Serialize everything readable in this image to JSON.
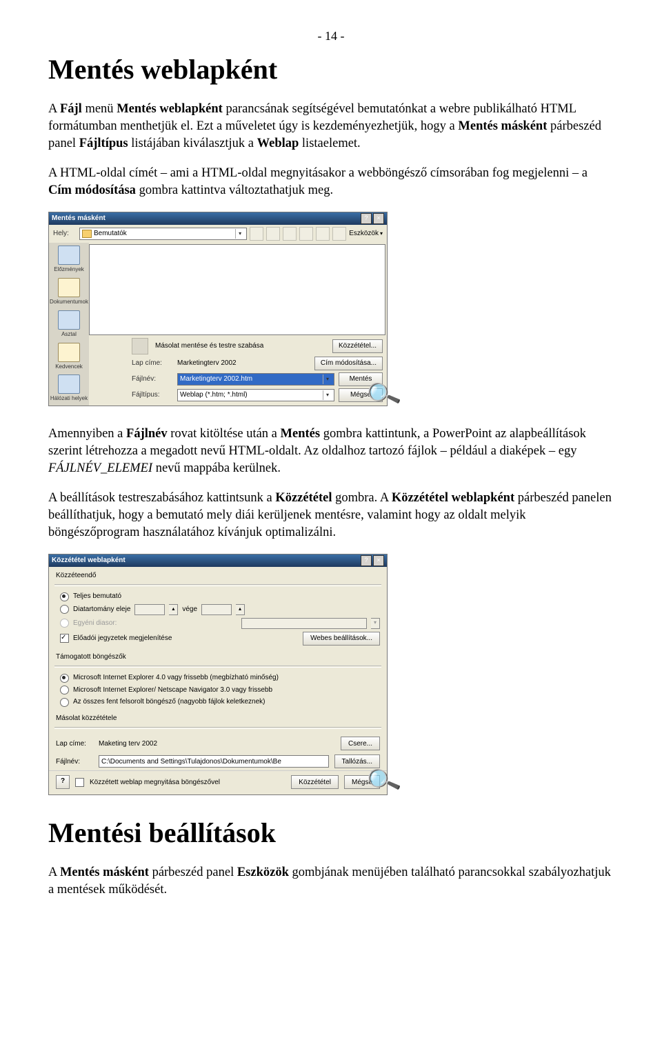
{
  "pageNumber": "- 14 -",
  "h1": "Mentés weblapként",
  "para1": "A Fájl menü Mentés weblapként parancsának segítségével bemutatónkat a webre publikálható HTML formátumban menthetjük el. Ezt a műveletet úgy is kezdeményezhetjük, hogy a Mentés másként párbeszéd panel Fájltípus listájában kiválasztjuk a Weblap listaelemet.",
  "para2": "A HTML-oldal címét – ami a HTML-oldal megnyitásakor a webböngésző címsorában fog megjelenni – a Cím módosítása gombra kattintva változtathatjuk meg.",
  "dialog1": {
    "title": "Mentés másként",
    "helyLabel": "Hely:",
    "folderName": "Bemutatók",
    "toolsLabel": "Eszközök",
    "sidebar": [
      {
        "label": "Előzmények"
      },
      {
        "label": "Dokumentumok"
      },
      {
        "label": "Asztal"
      },
      {
        "label": "Kedvencek"
      },
      {
        "label": "Hálózati helyek"
      }
    ],
    "copyText": "Másolat mentése és testre szabása",
    "publishBtn": "Közzététel...",
    "lapCimeLabel": "Lap címe:",
    "lapCimeValue": "Marketingterv 2002",
    "cimModBtn": "Cím módosítása...",
    "fajlnevLabel": "Fájlnév:",
    "fajlnevValue": "Marketingterv 2002.htm",
    "mentesBtn": "Mentés",
    "fajltipusLabel": "Fájltípus:",
    "fajltipusValue": "Weblap (*.htm; *.html)",
    "megseBtn": "Mégse"
  },
  "para3": "Amennyiben a Fájlnév rovat kitöltése után a Mentés gombra kattintunk, a PowerPoint az alapbeállítások szerint létrehozza a megadott nevű HTML-oldalt. Az oldalhoz tartozó fájlok – például a diaképek – egy FÁJLNÉV_ELEMEI nevű mappába kerülnek.",
  "para4": "A beállítások testreszabásához kattintsunk a Közzététel gombra. A Közzététel weblapként párbeszéd panelen beállíthatjuk, hogy a bemutató mely diái kerüljenek mentésre, valamint hogy az oldalt melyik böngészőprogram használatához kívánjuk optimalizálni.",
  "dialog2": {
    "title": "Közzététel weblapként",
    "g1Label": "Közzéteendő",
    "optFull": "Teljes bemutató",
    "optRange": "Diatartomány eleje",
    "optRangeEnd": "vége",
    "optCustom": "Egyéni diasor:",
    "chkNotes": "Előadói jegyzetek megjelenítése",
    "webSettingsBtn": "Webes beállítások...",
    "g2Label": "Támogatott böngészők",
    "b1": "Microsoft Internet Explorer 4.0 vagy frissebb (megbízható minőség)",
    "b2": "Microsoft Internet Explorer/ Netscape Navigator 3.0 vagy frissebb",
    "b3": "Az összes fent felsorolt böngésző (nagyobb fájlok keletkeznek)",
    "g3Label": "Másolat közzététele",
    "lapCimeLabel": "Lap címe:",
    "lapCimeValue": "Maketing terv 2002",
    "csereBtn": "Csere...",
    "fajlnevLabel": "Fájlnév:",
    "fajlnevValue": "C:\\Documents and Settings\\Tulajdonos\\Dokumentumok\\Be",
    "tallozasBtn": "Tallózás...",
    "chkOpen": "Közzétett weblap megnyitása böngészővel",
    "publishBtn": "Közzététel",
    "cancelBtn": "Mégse"
  },
  "h2": "Mentési beállítások",
  "para5": "A Mentés másként párbeszéd panel Eszközök gombjának menüjében található parancsokkal szabályozhatjuk a mentések működését."
}
